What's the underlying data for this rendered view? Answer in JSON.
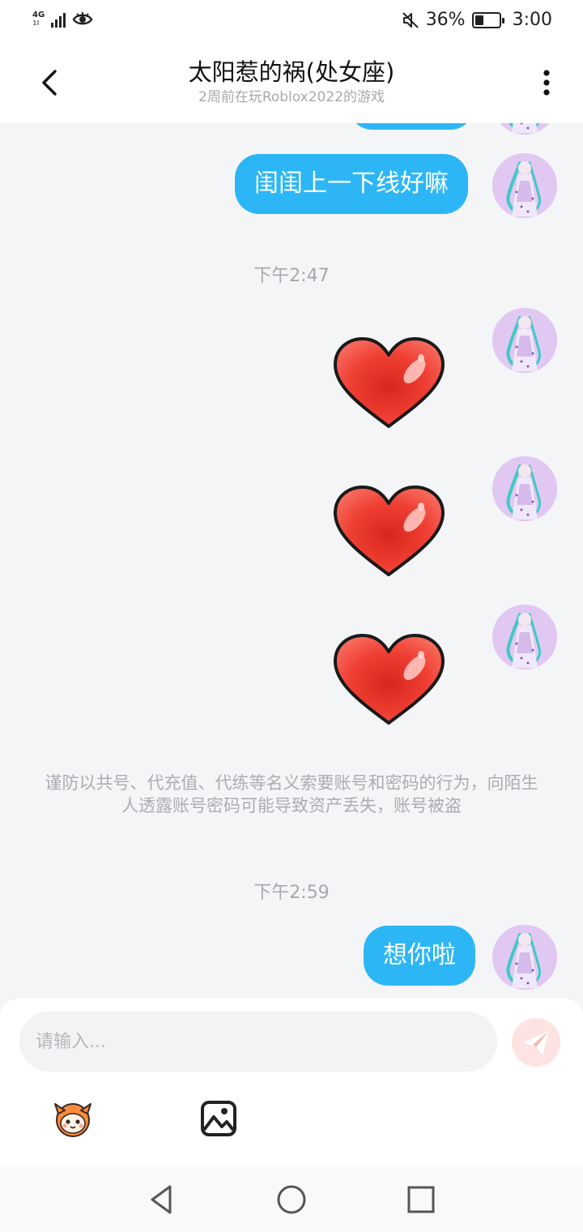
{
  "status_bar": {
    "network": "4G",
    "network_sub": "1l",
    "battery_percent_text": "36%",
    "battery_level": 0.36,
    "time": "3:00"
  },
  "header": {
    "title": "太阳惹的祸(处女座)",
    "subtitle": "2周前在玩Roblox2022的游戏",
    "back_icon": "chevron-left-icon",
    "more_icon": "more-vertical-icon"
  },
  "messages": {
    "msg_1": "闺闺上一下线好嘛",
    "time_1": "下午2:47",
    "sticker_icon": "heart-sticker",
    "notice": "谨防以共号、代充值、代练等名义索要账号和密码的行为，向陌生人透露账号密码可能导致资产丢失，账号被盗",
    "time_2": "下午2:59",
    "msg_2": "想你啦"
  },
  "composer": {
    "placeholder": "请输入...",
    "send_icon": "paper-plane-icon",
    "emoji_icon": "emoji-mascot-icon",
    "image_icon": "image-icon"
  },
  "colors": {
    "bubble": "#2db6f6",
    "chat_bg": "#f4f5f7",
    "send_button": "#fde3e1",
    "heart_red": "#ee3b2e"
  },
  "nav": {
    "back_icon": "triangle-back-icon",
    "home_icon": "circle-home-icon",
    "recents_icon": "square-recents-icon"
  }
}
